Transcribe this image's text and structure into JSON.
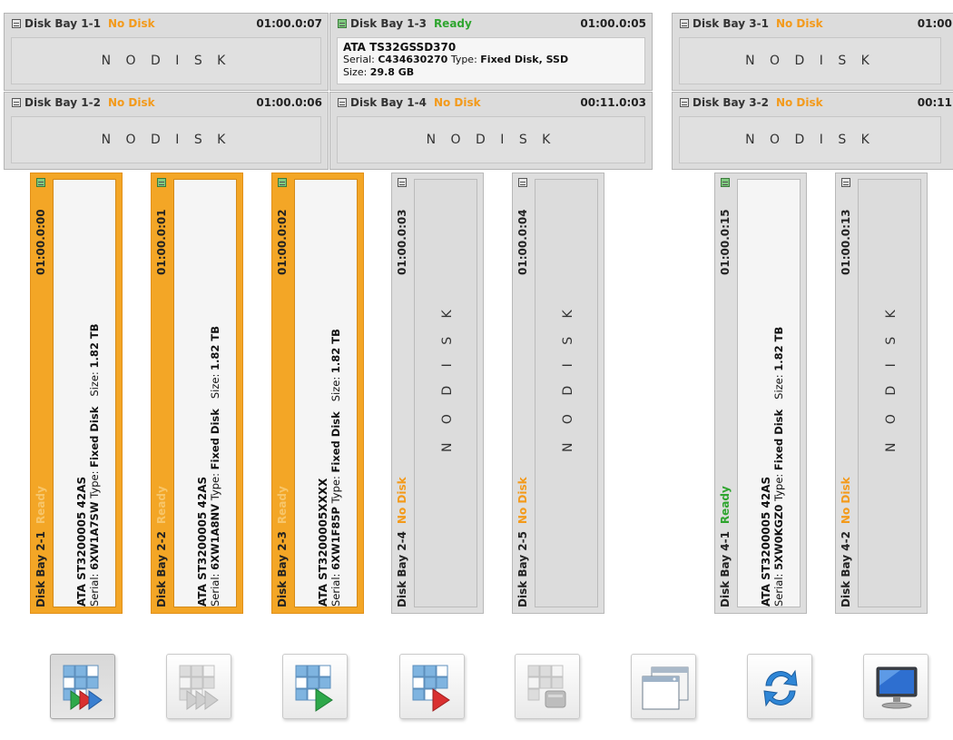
{
  "top_bays": [
    {
      "label": "Disk Bay 1-1",
      "status": "No Disk",
      "address": "01:00.0:07",
      "empty_text": "N O   D I S K"
    },
    {
      "label": "Disk Bay 1-3",
      "status": "Ready",
      "address": "01:00.0:05",
      "model": "ATA TS32GSSD370",
      "serial_label": "Serial:",
      "serial": "C434630270",
      "type_label": "Type:",
      "type": "Fixed Disk, SSD",
      "size_label": "Size:",
      "size": "29.8 GB"
    },
    {
      "label": "Disk Bay 3-1",
      "status": "No Disk",
      "address": "01:00",
      "empty_text": "N O   D I S K"
    },
    {
      "label": "Disk Bay 1-2",
      "status": "No Disk",
      "address": "01:00.0:06",
      "empty_text": "N O   D I S K"
    },
    {
      "label": "Disk Bay 1-4",
      "status": "No Disk",
      "address": "00:11.0:03",
      "empty_text": "N O   D I S K"
    },
    {
      "label": "Disk Bay 3-2",
      "status": "No Disk",
      "address": "00:11",
      "empty_text": "N O   D I S K"
    }
  ],
  "vertical_bays": [
    {
      "label": "Disk Bay 2-1",
      "status": "Ready",
      "address": "01:00.0:00",
      "model": "ATA ST3200005 42AS",
      "serial_label": "Serial:",
      "serial": "6XW1A7SW",
      "type_label": "Type:",
      "type": "Fixed Disk",
      "size_label": "Size:",
      "size": "1.82 TB",
      "selected": true
    },
    {
      "label": "Disk Bay 2-2",
      "status": "Ready",
      "address": "01:00.0:01",
      "model": "ATA ST3200005 42AS",
      "serial_label": "Serial:",
      "serial": "6XW1A8NV",
      "type_label": "Type:",
      "type": "Fixed Disk",
      "size_label": "Size:",
      "size": "1.82 TB",
      "selected": true
    },
    {
      "label": "Disk Bay 2-3",
      "status": "Ready",
      "address": "01:00.0:02",
      "model": "ATA ST3200005XXXX",
      "serial_label": "Serial:",
      "serial": "6XW1F85P",
      "type_label": "Type:",
      "type": "Fixed Disk",
      "size_label": "Size:",
      "size": "1.82 TB",
      "selected": true
    },
    {
      "label": "Disk Bay 2-4",
      "status": "No Disk",
      "address": "01:00.0:03",
      "empty_text": "N O   D I S K"
    },
    {
      "label": "Disk Bay 2-5",
      "status": "No Disk",
      "address": "01:00.0:04",
      "empty_text": "N O   D I S K"
    },
    {
      "label": "Disk Bay 4-1",
      "status": "Ready",
      "address": "01:00.0:15",
      "model": "ATA ST3200005 42AS",
      "serial_label": "Serial:",
      "serial": "5XW0KGZ0",
      "type_label": "Type:",
      "type": "Fixed Disk",
      "size_label": "Size:",
      "size": "1.82 TB",
      "selected": false
    },
    {
      "label": "Disk Bay 4-2",
      "status": "No Disk",
      "address": "01:00.0:13",
      "empty_text": "N O   D I S K"
    }
  ],
  "toolbar": [
    {
      "icon": "grid-fast-forward-icon",
      "state": "pressed"
    },
    {
      "icon": "grid-fast-forward-disabled-icon",
      "state": "disabled"
    },
    {
      "icon": "grid-play-icon",
      "state": "normal"
    },
    {
      "icon": "grid-play-red-icon",
      "state": "normal"
    },
    {
      "icon": "grid-disk-disabled-icon",
      "state": "disabled"
    },
    {
      "icon": "windows-icon",
      "state": "normal"
    },
    {
      "icon": "refresh-icon",
      "state": "normal"
    },
    {
      "icon": "monitor-icon",
      "state": "normal"
    }
  ],
  "colors": {
    "no_disk": "#f39a1b",
    "ready": "#2fa52f",
    "selected_bay": "#f3a626",
    "ready_on_selected": "#f7c66b"
  }
}
